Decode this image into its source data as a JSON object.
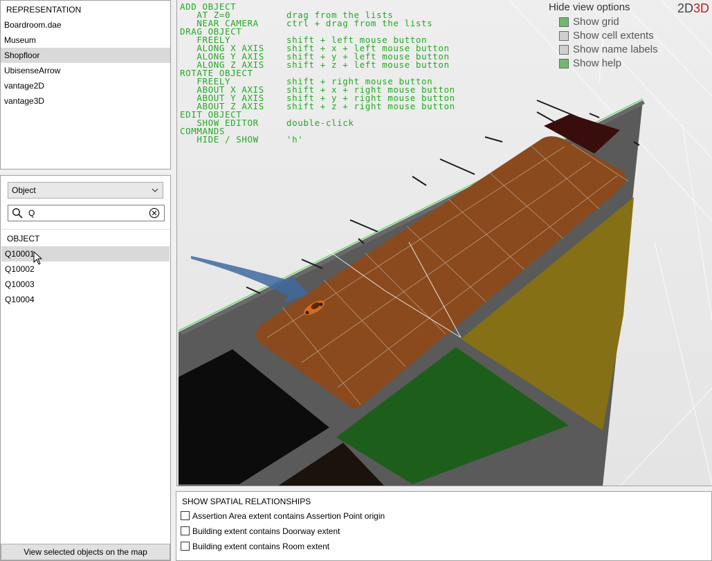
{
  "representation": {
    "header": "REPRESENTATION",
    "items": [
      "Boardroom.dae",
      "Museum",
      "Shopfloor",
      "UbisenseArrow",
      "vantage2D",
      "vantage3D"
    ],
    "selected_index": 2
  },
  "object_panel": {
    "type_select": "Object",
    "search_value": "Q",
    "list_header": "OBJECT",
    "items": [
      "Q10001",
      "Q10002",
      "Q10003",
      "Q10004"
    ],
    "selected_index": 0,
    "view_button": "View selected objects on the map"
  },
  "help": {
    "rows": [
      [
        "ADD OBJECT",
        ""
      ],
      [
        "   AT Z=0",
        "drag from the lists"
      ],
      [
        "   NEAR CAMERA",
        "ctrl + drag from the lists"
      ],
      [
        "DRAG OBJECT",
        ""
      ],
      [
        "   FREELY",
        "shift + left mouse button"
      ],
      [
        "   ALONG X AXIS",
        "shift + x + left mouse button"
      ],
      [
        "   ALONG Y AXIS",
        "shift + y + left mouse button"
      ],
      [
        "   ALONG Z AXIS",
        "shift + z + left mouse button"
      ],
      [
        "ROTATE OBJECT",
        ""
      ],
      [
        "   FREELY",
        "shift + right mouse button"
      ],
      [
        "   ABOUT X AXIS",
        "shift + x + right mouse button"
      ],
      [
        "   ABOUT Y AXIS",
        "shift + y + right mouse button"
      ],
      [
        "   ABOUT Z AXIS",
        "shift + z + right mouse button"
      ],
      [
        "EDIT OBJECT",
        ""
      ],
      [
        "   SHOW EDITOR",
        "double-click"
      ],
      [
        "COMMANDS",
        ""
      ],
      [
        "   HIDE / SHOW",
        "'h'"
      ]
    ]
  },
  "view_options": {
    "title": "Hide view options",
    "options": [
      {
        "label": "Show grid",
        "checked": true
      },
      {
        "label": "Show cell extents",
        "checked": false
      },
      {
        "label": "Show name labels",
        "checked": false
      },
      {
        "label": "Show help",
        "checked": true
      }
    ]
  },
  "mode": {
    "label_2d": "2D",
    "label_3d": "3D"
  },
  "spatial": {
    "title": "SHOW SPATIAL RELATIONSHIPS",
    "items": [
      "Assertion Area extent contains Assertion Point origin",
      "Building extent contains Doorway extent",
      "Building extent contains Room extent"
    ]
  },
  "colors": {
    "floor": "#5a5a5a",
    "orange_area": "#8a4a1e",
    "yellow_area": "#857015",
    "green_area": "#1d5e1a",
    "help_text": "#23a823",
    "mode_3d": "#b22222"
  }
}
